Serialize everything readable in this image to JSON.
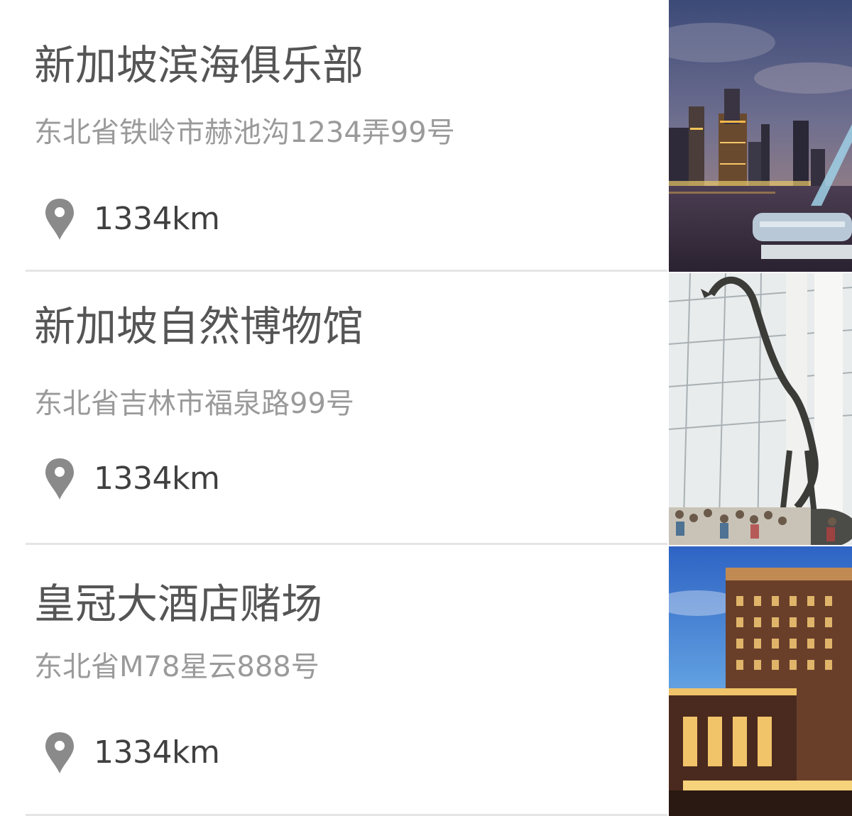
{
  "places": [
    {
      "name": "新加坡滨海俱乐部",
      "address": "东北省铁岭市赫池沟1234弄99号",
      "distance": "1334km",
      "icon": "map-pin-icon",
      "image": "city-skyline-night-photo"
    },
    {
      "name": "新加坡自然博物馆",
      "address": "东北省吉林市福泉路99号",
      "distance": "1334km",
      "icon": "map-pin-icon",
      "image": "museum-dinosaur-skeleton-photo"
    },
    {
      "name": "皇冠大酒店赌场",
      "address": "东北省M78星云888号",
      "distance": "1334km",
      "icon": "map-pin-icon",
      "image": "hotel-building-dusk-photo"
    }
  ],
  "colors": {
    "title": "#555555",
    "address": "#9a9a9a",
    "distance": "#404040",
    "divider": "#e5e5e5",
    "pin": "#8a8a8a"
  }
}
